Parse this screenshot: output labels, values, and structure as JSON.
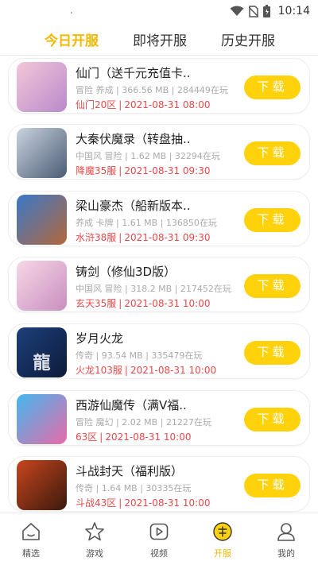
{
  "status_bar": {
    "time": "10:14"
  },
  "tabs": [
    {
      "label": "今日开服",
      "active": true
    },
    {
      "label": "即将开服",
      "active": false
    },
    {
      "label": "历史开服",
      "active": false
    }
  ],
  "games": [
    {
      "title": "仙门（送千元充值卡..",
      "meta": "冒险 养成 | 366.56 MB | 284449在玩",
      "server": "仙门20区",
      "time": "2021-08-31 08:00",
      "download_label": "下载",
      "thumb_colors": [
        "#f3c6d8",
        "#b98acb"
      ]
    },
    {
      "title": "大秦伏魔录（转盘抽..",
      "meta": "中国风 冒险 | 1.62 MB | 32294在玩",
      "server": "降魔35服",
      "time": "2021-08-31 09:30",
      "download_label": "下载",
      "thumb_colors": [
        "#c9d3df",
        "#4b5c74"
      ]
    },
    {
      "title": "梁山豪杰（船新版本..",
      "meta": "养成 卡牌 | 1.61 MB | 136850在玩",
      "server": "水浒38服",
      "time": "2021-08-31 09:30",
      "download_label": "下载",
      "thumb_colors": [
        "#3a78c9",
        "#b3683b"
      ]
    },
    {
      "title": "铸剑（修仙3D版）",
      "meta": "中国风 冒险 | 318.2 MB | 217452在玩",
      "server": "玄天35服",
      "time": "2021-08-31 10:00",
      "download_label": "下载",
      "thumb_colors": [
        "#f7d7e6",
        "#c98fc0"
      ]
    },
    {
      "title": "岁月火龙",
      "meta": "传奇 | 93.54 MB | 335479在玩",
      "server": "火龙103服",
      "time": "2021-08-31 10:00",
      "download_label": "下载",
      "thumb_colors": [
        "#1d3f7a",
        "#0d1b3a"
      ],
      "thumb_glyph": "龍"
    },
    {
      "title": "西游仙魔传（满V福..",
      "meta": "冒险 魔幻 | 2.02 MB | 21227在玩",
      "server": "63区",
      "time": "2021-08-31 10:00",
      "download_label": "下载",
      "thumb_colors": [
        "#43b8f0",
        "#e86aa8"
      ]
    },
    {
      "title": "斗战封天（福利版）",
      "meta": "传奇 | 1.64 MB | 30335在玩",
      "server": "斗战43区",
      "time": "2021-08-31 10:00",
      "download_label": "下载",
      "thumb_colors": [
        "#c8441d",
        "#3a1a0d"
      ]
    }
  ],
  "bottom_nav": [
    {
      "label": "精选",
      "icon": "home-icon",
      "active": false
    },
    {
      "label": "游戏",
      "icon": "star-icon",
      "active": false
    },
    {
      "label": "视频",
      "icon": "play-icon",
      "active": false
    },
    {
      "label": "开服",
      "icon": "server-icon",
      "active": true
    },
    {
      "label": "我的",
      "icon": "user-icon",
      "active": false
    }
  ],
  "colors": {
    "accent": "#f5b800",
    "button": "#ffd20c",
    "server_text": "#e84a4a"
  }
}
